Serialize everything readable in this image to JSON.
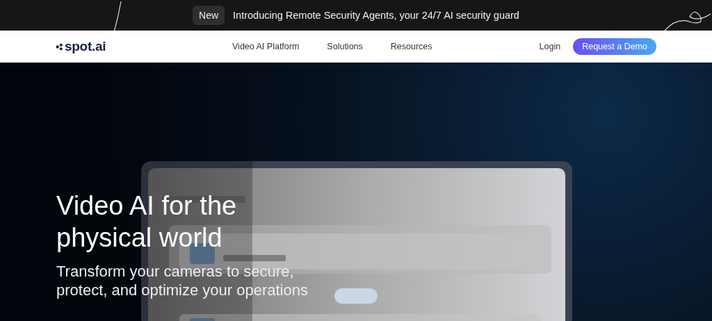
{
  "announcement": {
    "badge": "New",
    "text": "Introducing Remote Security Agents, your 24/7 AI security guard"
  },
  "nav": {
    "logo": "spot.ai",
    "links": [
      "Video AI Platform",
      "Solutions",
      "Resources"
    ],
    "login": "Login",
    "cta": "Request a Demo"
  },
  "hero": {
    "headline": "Video AI for the physical world",
    "subtitle": "Transform your cameras to secure, protect, and optimize your operations"
  }
}
